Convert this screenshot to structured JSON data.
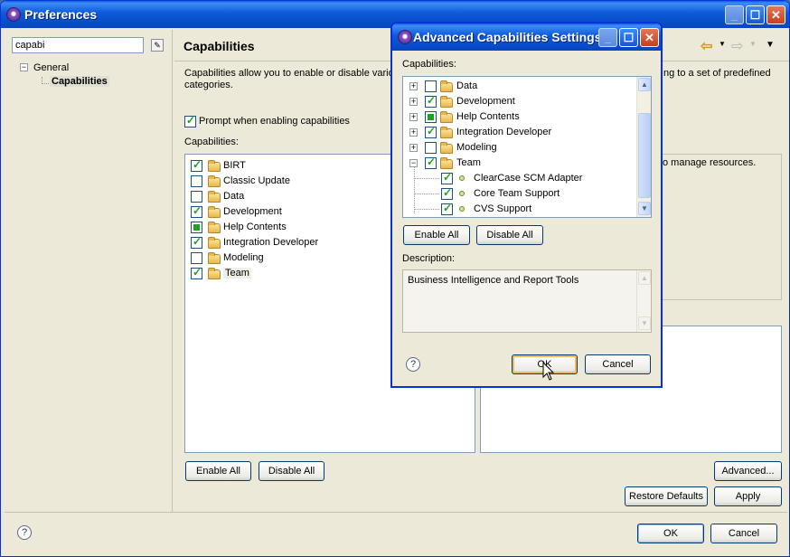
{
  "main_window": {
    "title": "Preferences",
    "filter_value": "capabi",
    "tree": {
      "root": "General",
      "child": "Capabilities"
    },
    "page_title": "Capabilities",
    "description_left": "Capabilities allow you to enable or disable variou",
    "description_right": "ng to a set of predefined",
    "description_line2": "categories.",
    "prompt_label": "Prompt when enabling capabilities",
    "capabilities_label": "Capabilities:",
    "right_panel_text": "o manage resources.",
    "capabilities": [
      {
        "label": "BIRT",
        "state": "on"
      },
      {
        "label": "Classic Update",
        "state": "off"
      },
      {
        "label": "Data",
        "state": "off"
      },
      {
        "label": "Development",
        "state": "on"
      },
      {
        "label": "Help Contents",
        "state": "partial"
      },
      {
        "label": "Integration Developer",
        "state": "on"
      },
      {
        "label": "Modeling",
        "state": "off"
      },
      {
        "label": "Team",
        "state": "on"
      }
    ],
    "buttons": {
      "enable_all": "Enable All",
      "disable_all": "Disable All",
      "advanced": "Advanced...",
      "restore_defaults": "Restore Defaults",
      "apply": "Apply",
      "ok": "OK",
      "cancel": "Cancel"
    }
  },
  "dialog": {
    "title": "Advanced Capabilities Settings",
    "capabilities_label": "Capabilities:",
    "tree": [
      {
        "label": "Data",
        "state": "off",
        "expander": "+"
      },
      {
        "label": "Development",
        "state": "on",
        "expander": "+"
      },
      {
        "label": "Help Contents",
        "state": "partial",
        "expander": "+"
      },
      {
        "label": "Integration Developer",
        "state": "on",
        "expander": "+"
      },
      {
        "label": "Modeling",
        "state": "off",
        "expander": "+"
      },
      {
        "label": "Team",
        "state": "on",
        "expander": "-"
      }
    ],
    "team_children": [
      {
        "label": "ClearCase SCM Adapter",
        "state": "on"
      },
      {
        "label": "Core Team Support",
        "state": "on"
      },
      {
        "label": "CVS Support",
        "state": "on"
      }
    ],
    "enable_all": "Enable All",
    "disable_all": "Disable All",
    "description_label": "Description:",
    "description_text": "Business Intelligence and Report Tools",
    "ok": "OK",
    "cancel": "Cancel"
  },
  "colors": {
    "accent": "#0b5ad8",
    "checkbox_green": "#21a121"
  }
}
